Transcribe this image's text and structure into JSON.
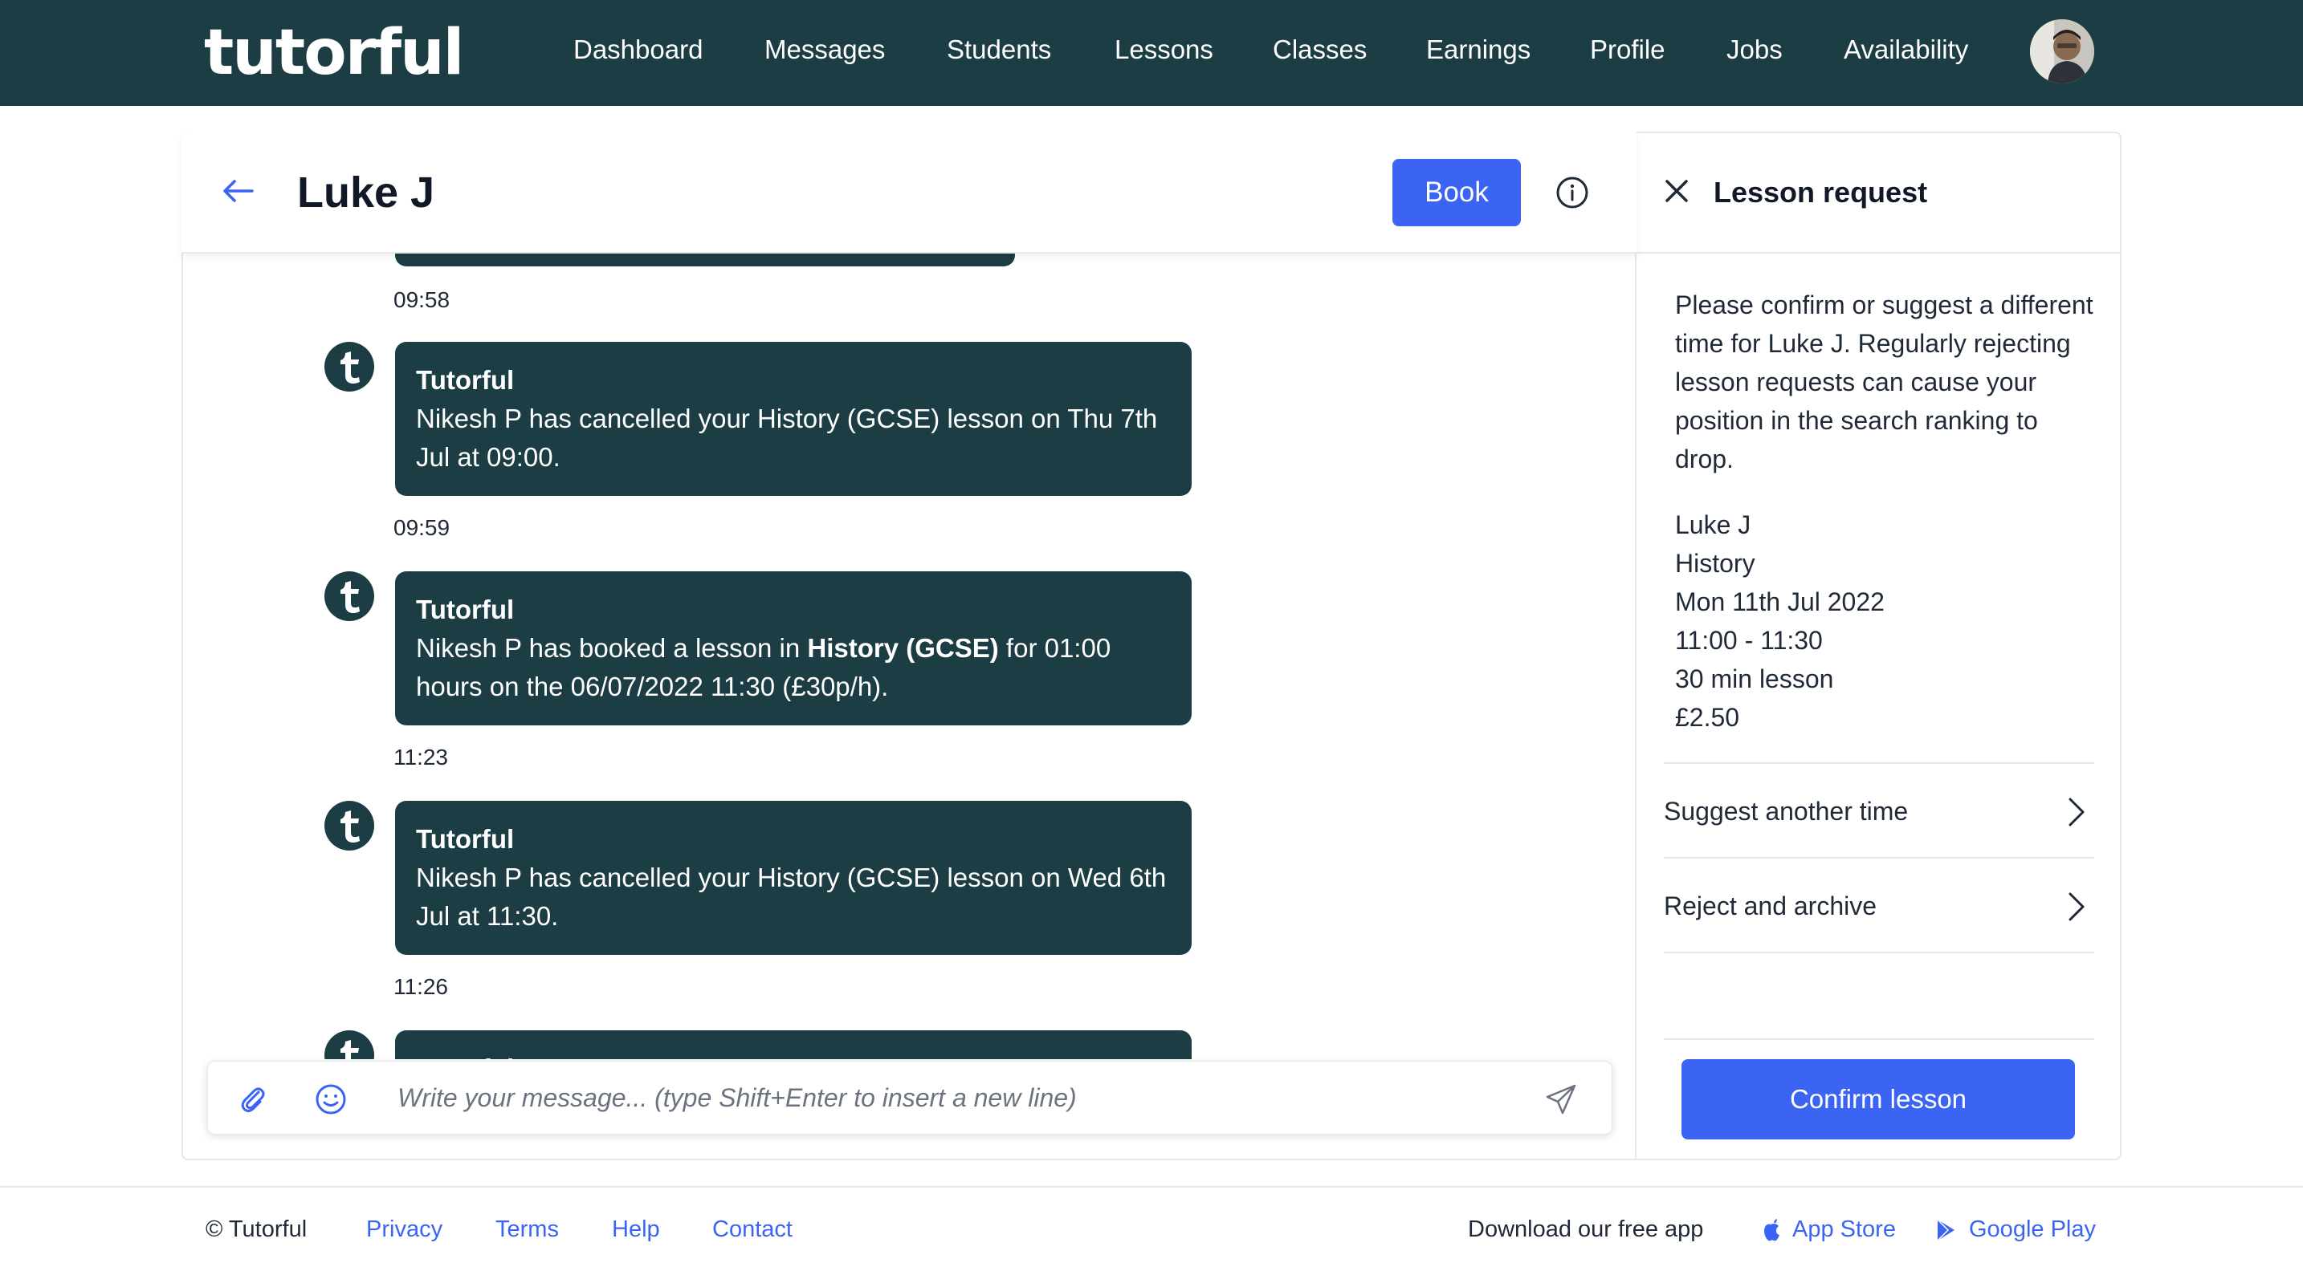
{
  "nav": {
    "logo": "tutorful",
    "links": [
      "Dashboard",
      "Messages",
      "Students",
      "Lessons",
      "Classes",
      "Earnings",
      "Profile",
      "Jobs",
      "Availability"
    ]
  },
  "chat": {
    "title": "Luke J",
    "book_label": "Book",
    "messages": [
      {
        "time": "09:58"
      },
      {
        "sender": "Tutorful",
        "text": "Nikesh P has cancelled your History (GCSE) lesson on Thu 7th Jul at 09:00.",
        "time": "09:59"
      },
      {
        "sender": "Tutorful",
        "text_before": "Nikesh P has booked a lesson in ",
        "text_bold": "History (GCSE)",
        "text_after": " for 01:00 hours on the 06/07/2022 11:30 (£30p/h).",
        "time": "11:23"
      },
      {
        "sender": "Tutorful",
        "text": "Nikesh P has cancelled your History (GCSE) lesson on Wed 6th Jul at 11:30.",
        "time": "11:26"
      },
      {
        "sender": "Tutorful"
      }
    ],
    "input": {
      "placeholder": "Write your message... (type Shift+Enter to insert a new line)",
      "value": ""
    }
  },
  "panel": {
    "title": "Lesson request",
    "description": "Please confirm or suggest a different time for Luke J. Regularly rejecting lesson requests can cause your position in the search ranking to drop.",
    "details": {
      "name": "Luke J",
      "subject": "History",
      "date": "Mon 11th Jul 2022",
      "time": "11:00 - 11:30",
      "duration": "30 min lesson",
      "price": "£2.50"
    },
    "suggest_label": "Suggest another time",
    "reject_label": "Reject and archive",
    "confirm_label": "Confirm lesson"
  },
  "footer": {
    "copyright": "© Tutorful",
    "links": [
      "Privacy",
      "Terms",
      "Help",
      "Contact"
    ],
    "download_text": "Download our free app",
    "app_store": "App Store",
    "google_play": "Google Play"
  },
  "colors": {
    "brand_dark": "#1c3d44",
    "accent_blue": "#3b64f5"
  },
  "icons": [
    "back-arrow-icon",
    "info-icon",
    "tutorful-t-icon",
    "paperclip-icon",
    "emoji-icon",
    "send-icon",
    "close-icon",
    "chevron-right-icon",
    "apple-icon",
    "google-play-icon"
  ]
}
